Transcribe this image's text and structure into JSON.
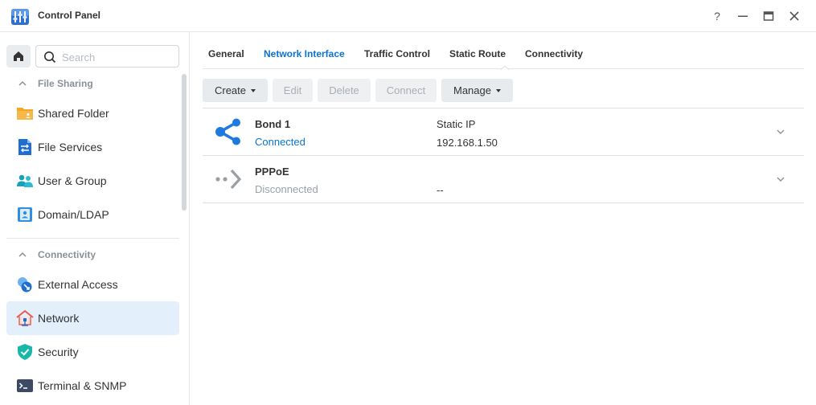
{
  "window": {
    "title": "Control Panel",
    "help_symbol": "?"
  },
  "sidebar": {
    "search_placeholder": "Search",
    "sections": [
      {
        "label": "File Sharing",
        "items": [
          {
            "label": "Shared Folder",
            "icon": "shared-folder-icon"
          },
          {
            "label": "File Services",
            "icon": "file-services-icon"
          },
          {
            "label": "User & Group",
            "icon": "user-group-icon"
          },
          {
            "label": "Domain/LDAP",
            "icon": "domain-ldap-icon"
          }
        ]
      },
      {
        "label": "Connectivity",
        "items": [
          {
            "label": "External Access",
            "icon": "external-access-icon"
          },
          {
            "label": "Network",
            "icon": "network-icon",
            "active": true
          },
          {
            "label": "Security",
            "icon": "security-icon"
          },
          {
            "label": "Terminal & SNMP",
            "icon": "terminal-icon"
          }
        ]
      }
    ]
  },
  "tabs": [
    {
      "label": "General"
    },
    {
      "label": "Network Interface",
      "active": true
    },
    {
      "label": "Traffic Control"
    },
    {
      "label": "Static Route"
    },
    {
      "label": "Connectivity"
    }
  ],
  "toolbar": {
    "create": "Create",
    "edit": "Edit",
    "delete": "Delete",
    "connect": "Connect",
    "manage": "Manage"
  },
  "interfaces": [
    {
      "name": "Bond 1",
      "status": "Connected",
      "type": "Static IP",
      "ip": "192.168.1.50",
      "icon": "bond-share-icon"
    },
    {
      "name": "PPPoE",
      "status": "Disconnected",
      "type": "",
      "ip": "--",
      "icon": "pppoe-icon"
    }
  ],
  "colors": {
    "accent": "#0a74d4",
    "connected": "#0a74d4",
    "disconnected": "#9aa0a6",
    "active_nav_bg": "#e3f0fc"
  }
}
